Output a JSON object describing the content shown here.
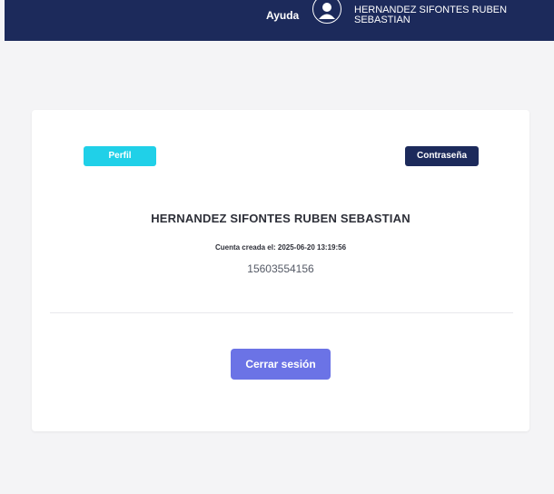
{
  "header": {
    "help_label": "Ayuda",
    "user_name": "HERNANDEZ SIFONTES RUBEN SEBASTIAN",
    "avatar_icon": "user-circle-icon"
  },
  "profile": {
    "tab_profile_label": "Perfil",
    "tab_password_label": "Contraseña",
    "full_name": "HERNANDEZ SIFONTES RUBEN SEBASTIAN",
    "created_text": "Cuenta creada el: 2025-06-20 13:19:56",
    "phone": "15603554156",
    "logout_label": "Cerrar sesión"
  },
  "colors": {
    "header_bg": "#1c2a5b",
    "profile_tab": "#20d0e8",
    "password_tab": "#1c2a5b",
    "logout_button": "#6b73e6"
  }
}
